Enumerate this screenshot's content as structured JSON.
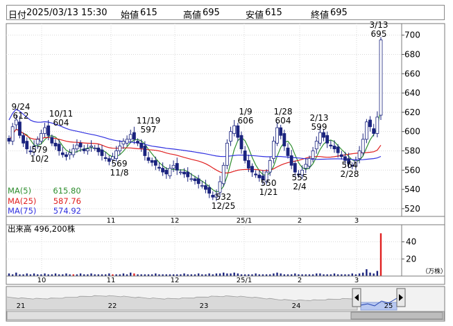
{
  "header": {
    "date_label": "日付",
    "datetime": "2025/03/13 15:30",
    "open_label": "始値",
    "open": "615",
    "high_label": "高値",
    "high": "695",
    "low_label": "安値",
    "low": "615",
    "close_label": "終値",
    "close": "695"
  },
  "price_axis": {
    "ticks": [
      "700",
      "680",
      "660",
      "640",
      "620",
      "600",
      "580",
      "560",
      "540",
      "520"
    ],
    "ylim": [
      512,
      712
    ]
  },
  "month_labels": [
    "10",
    "11",
    "12",
    "25/1",
    "2",
    "3"
  ],
  "ma_legend": [
    {
      "label": "MA(5)",
      "value": "615.80",
      "color": "#2f8f2f"
    },
    {
      "label": "MA(25)",
      "value": "587.76",
      "color": "#e02020"
    },
    {
      "label": "MA(75)",
      "value": "574.92",
      "color": "#3030e0"
    }
  ],
  "annotations": [
    {
      "date": "9/24",
      "value": "612"
    },
    {
      "date": "10/2",
      "value": "579"
    },
    {
      "date": "10/11",
      "value": "604"
    },
    {
      "date": "11/8",
      "value": "569"
    },
    {
      "date": "11/19",
      "value": "597"
    },
    {
      "date": "12/25",
      "value": "532"
    },
    {
      "date": "1/9",
      "value": "606"
    },
    {
      "date": "1/21",
      "value": "550"
    },
    {
      "date": "1/28",
      "value": "604"
    },
    {
      "date": "2/4",
      "value": "555"
    },
    {
      "date": "2/13",
      "value": "599"
    },
    {
      "date": "2/28",
      "value": "564"
    },
    {
      "date": "3/13",
      "value": "695"
    }
  ],
  "volume": {
    "title_label": "出来高",
    "value": "496,200株",
    "ticks": [
      "40",
      "20"
    ],
    "unit": "（万株）"
  },
  "navigator": {
    "year_labels": [
      "21",
      "22",
      "23",
      "24",
      "25"
    ]
  },
  "chart_data": {
    "type": "candlestick",
    "ylim": [
      512,
      712
    ],
    "colors": {
      "up": "#ffffff",
      "down": "#1a237e",
      "ma5": "#2f8f2f",
      "ma25": "#e02020",
      "ma75": "#3030e0"
    },
    "close": [
      590,
      605,
      612,
      596,
      588,
      582,
      579,
      585,
      592,
      598,
      604,
      596,
      588,
      585,
      580,
      576,
      574,
      578,
      582,
      586,
      584,
      580,
      582,
      585,
      583,
      579,
      575,
      572,
      569,
      574,
      580,
      585,
      590,
      592,
      597,
      592,
      588,
      583,
      575,
      570,
      568,
      565,
      562,
      558,
      556,
      562,
      565,
      560,
      558,
      556,
      553,
      551,
      549,
      546,
      544,
      540,
      536,
      532,
      535,
      548,
      565,
      588,
      600,
      606,
      594,
      582,
      570,
      562,
      558,
      555,
      552,
      550,
      558,
      570,
      590,
      604,
      596,
      585,
      575,
      565,
      558,
      555,
      560,
      566,
      572,
      580,
      590,
      599,
      594,
      588,
      585,
      582,
      578,
      574,
      570,
      567,
      564,
      570,
      580,
      592,
      610,
      605,
      598,
      615,
      695
    ],
    "volume": [
      3,
      2,
      4,
      2,
      2,
      3,
      2,
      3,
      2,
      2,
      3,
      2,
      2,
      3,
      2,
      2,
      3,
      2,
      2,
      2,
      3,
      2,
      2,
      3,
      2,
      2,
      2,
      2,
      3,
      2,
      2,
      2,
      3,
      2,
      4,
      3,
      2,
      2,
      2,
      2,
      2,
      3,
      2,
      2,
      2,
      2,
      2,
      2,
      2,
      3,
      2,
      2,
      2,
      3,
      2,
      2,
      3,
      2,
      3,
      3,
      4,
      3,
      3,
      4,
      3,
      2,
      2,
      2,
      2,
      3,
      2,
      2,
      2,
      2,
      3,
      4,
      3,
      2,
      2,
      2,
      3,
      2,
      2,
      2,
      2,
      2,
      3,
      3,
      2,
      2,
      2,
      3,
      2,
      2,
      2,
      2,
      3,
      2,
      3,
      4,
      8,
      4,
      3,
      6,
      50
    ],
    "highlight_volume_index": [
      18,
      29,
      35,
      104
    ]
  }
}
